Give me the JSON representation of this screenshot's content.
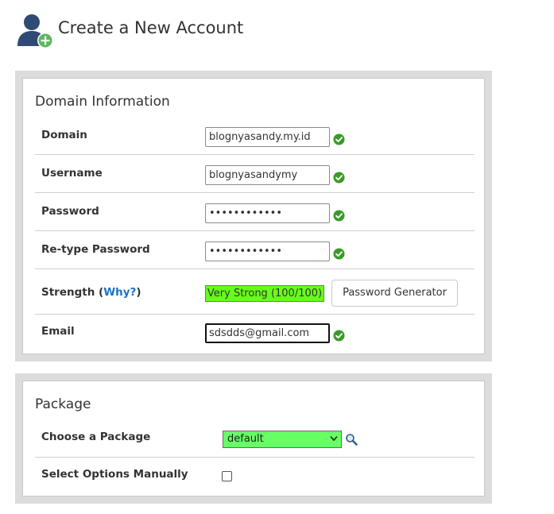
{
  "header": {
    "title": "Create a New Account",
    "icon": "user-add-icon"
  },
  "domain_info": {
    "title": "Domain Information",
    "domain": {
      "label": "Domain",
      "value": "blognyasandy.my.id",
      "status_icon": "check-icon"
    },
    "username": {
      "label": "Username",
      "value": "blognyasandymy",
      "status_icon": "check-icon"
    },
    "password": {
      "label": "Password",
      "value": "••••••••••••",
      "status_icon": "check-icon"
    },
    "retype_password": {
      "label": "Re-type Password",
      "value": "••••••••••••",
      "status_icon": "check-icon"
    },
    "strength": {
      "label": "Strength (",
      "why_link": "Why?",
      "label_close": ")",
      "meter_text": "Very Strong (100/100)",
      "meter_value": 100,
      "meter_color": "#66ff1a",
      "generator_button": "Password Generator"
    },
    "email": {
      "label": "Email",
      "value": "sdsdds@gmail.com",
      "status_icon": "check-icon"
    }
  },
  "package": {
    "title": "Package",
    "choose": {
      "label": "Choose a Package",
      "selected": "default",
      "select_color": "#66ff66",
      "search_icon": "magnifier-icon"
    },
    "manual": {
      "label": "Select Options Manually",
      "checked": false
    }
  },
  "colors": {
    "ok_green": "#3a9a2a",
    "link_blue": "#1a74c7",
    "panel_border": "#dcdcdc"
  }
}
